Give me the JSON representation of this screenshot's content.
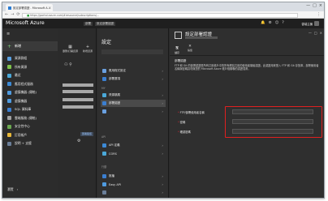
{
  "browser": {
    "tab_title": "設定部署認證 - Microsoft A...",
    "tab_close": "×",
    "url": "https://portal.azure.com/#resource/subscriptions/...",
    "nav_back": "←",
    "nav_forward": "→",
    "nav_reload": "⟳",
    "menu": "⋮",
    "controls": [
      "—",
      "□",
      "×"
    ]
  },
  "azure": {
    "brand": "Microsoft Azure",
    "breadcrumbs": [
      "部署",
      "設定部署認證"
    ],
    "user_label": "雲端主機"
  },
  "leftnav": {
    "new_label": "新增",
    "items": [
      {
        "label": "資源群組",
        "color": "#5aa0e0"
      },
      {
        "label": "所有資源",
        "color": "#7fc24a"
      },
      {
        "label": "最近",
        "color": "#4aa8d8"
      },
      {
        "label": "應用程式服務",
        "color": "#3c8ad6"
      },
      {
        "label": "虛擬機器 (傳統)",
        "color": "#4f9be0"
      },
      {
        "label": "虛擬機器",
        "color": "#4f9be0"
      },
      {
        "label": "SQL 資料庫",
        "color": "#3b7fd1"
      },
      {
        "label": "雲端服務 (傳統)",
        "color": "#a0a0a0"
      },
      {
        "label": "安全性中心",
        "color": "#6aa84f"
      },
      {
        "label": "訂用帳戶",
        "color": "#e8b83a"
      },
      {
        "label": "說明 + 支援",
        "color": "#6b7f99"
      }
    ],
    "browse_label": "瀏覽",
    "browse_chevron": "›"
  },
  "blade1": {
    "btn1_label": "瀏覽/打開資源",
    "btn2_label": "新增資源",
    "chip": "部署路徑"
  },
  "blade2": {
    "title": "設定",
    "sections": [
      "MY",
      "API",
      "行動"
    ],
    "items": [
      "應用程式設定",
      "部署選項",
      "部署認證",
      "資源擴展",
      "API 定義",
      "CORS",
      "推播",
      "Easy API"
    ]
  },
  "blade3": {
    "title": "設定部署認證",
    "cmd_save": "儲存",
    "cmd_discard": "捨棄",
    "heading": "部署認證",
    "description": "FTP 和 Git 的部署認證是所有訂用帳戶中的所有網站共用的使用者層級認證。此認證用來登入 FTP 和 Git 存放庫，部署使用者名稱與密碼請勿與您的 Microsoft Azure 帳戶相關聯的認證混淆。",
    "fields": [
      {
        "label": "FTP/部署使用者名稱"
      },
      {
        "label": "密碼"
      },
      {
        "label": "確認密碼"
      }
    ],
    "required_mark": "*"
  }
}
